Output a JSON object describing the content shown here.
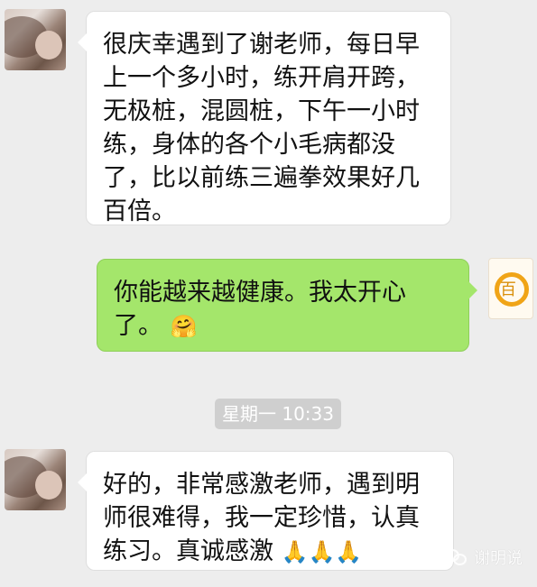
{
  "chat": {
    "messages": [
      {
        "side": "left",
        "text": "很庆幸遇到了谢老师，每日早上一个多小时，练开肩开跨，无极桩，混圆桩，下午一小时练，身体的各个小毛病都没了，比以前练三遍拳效果好几百倍。"
      },
      {
        "side": "right",
        "text": "你能越来越健康。我太开心了。",
        "emoji": "🤗"
      },
      {
        "side": "left",
        "text": "好的，非常感激老师，遇到明师很难得，我一定珍惜，认真练习。真诚感激",
        "emoji": "🙏🙏🙏"
      }
    ],
    "timestamp": "星期一 10:33"
  },
  "avatars": {
    "right_logo_text": "百"
  },
  "watermark": {
    "text": "谢明说",
    "icon": "wechat-icon"
  },
  "colors": {
    "background": "#ededed",
    "incoming_bubble": "#ffffff",
    "outgoing_bubble": "#a4e66b",
    "timestamp_bg": "#cfcfcf"
  }
}
